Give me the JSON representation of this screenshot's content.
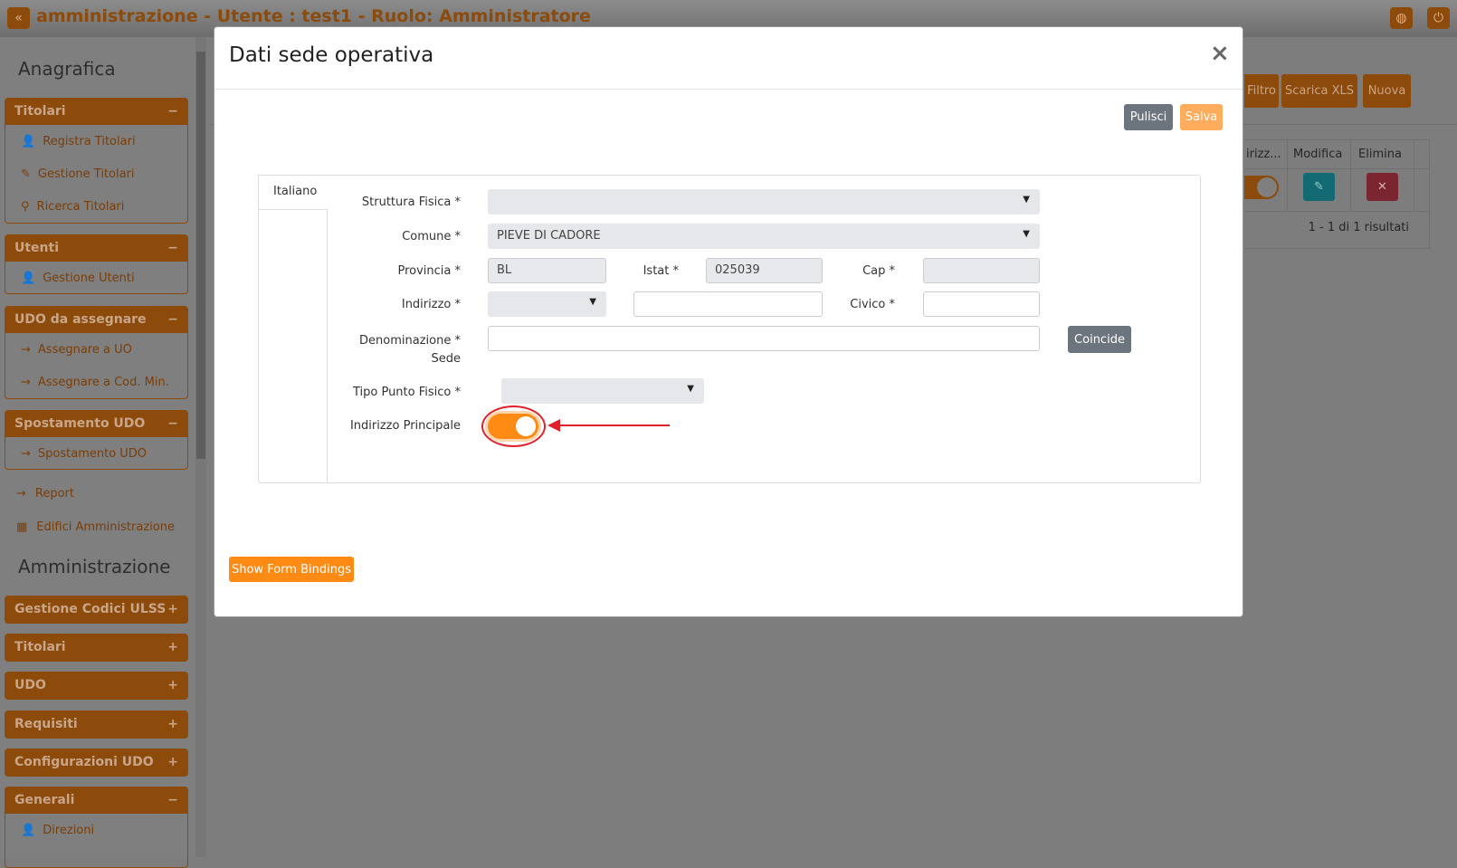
{
  "topbar": {
    "title": "amministrazione - Utente : test1 - Ruolo: Amministratore",
    "collapse_icon": "«",
    "globe_icon": "globe-icon",
    "power_icon": "power-icon"
  },
  "sidebar": {
    "heading1": "Anagrafica",
    "groups": [
      {
        "title": "Titolari",
        "toggle": "−",
        "items": [
          "Registra Titolari",
          "Gestione Titolari",
          "Ricerca Titolari"
        ]
      },
      {
        "title": "Utenti",
        "toggle": "−",
        "items": [
          "Gestione Utenti"
        ]
      },
      {
        "title": "UDO da assegnare",
        "toggle": "−",
        "items": [
          "Assegnare a UO",
          "Assegnare a Cod. Min."
        ]
      },
      {
        "title": "Spostamento UDO",
        "toggle": "−",
        "items": [
          "Spostamento UDO"
        ]
      }
    ],
    "links": [
      "Report",
      "Edifici Amministrazione"
    ],
    "heading2": "Amministrazione",
    "admin_groups": [
      {
        "title": "Gestione Codici ULSS",
        "toggle": "+"
      },
      {
        "title": "Titolari",
        "toggle": "+"
      },
      {
        "title": "UDO",
        "toggle": "+"
      },
      {
        "title": "Requisiti",
        "toggle": "+"
      },
      {
        "title": "Configurazioni UDO",
        "toggle": "+"
      },
      {
        "title": "Generali",
        "toggle": "−",
        "items": [
          "Direzioni"
        ]
      }
    ]
  },
  "background": {
    "buttons": [
      "Filtro",
      "Scarica XLS",
      "Nuova"
    ],
    "table_headers": [
      "irizz...",
      "Modifica",
      "Elimina"
    ],
    "pagination": "1 - 1 di 1 risultati"
  },
  "modal": {
    "title": "Dati sede operativa",
    "close": "×",
    "pulisci": "Pulisci",
    "salva": "Salva",
    "tab": "Italiano",
    "fields": {
      "struttura_fisica": {
        "label": "Struttura Fisica *",
        "value": ""
      },
      "comune": {
        "label": "Comune *",
        "value": "PIEVE DI CADORE"
      },
      "provincia": {
        "label": "Provincia *",
        "value": "BL"
      },
      "istat": {
        "label": "Istat *",
        "value": "025039"
      },
      "cap": {
        "label": "Cap *",
        "value": ""
      },
      "indirizzo": {
        "label": "Indirizzo *",
        "value": ""
      },
      "civico": {
        "label": "Civico *",
        "value": ""
      },
      "denominazione": {
        "label1": "Denominazione *",
        "label2": "Sede",
        "value": ""
      },
      "tipo_punto_fisico": {
        "label": "Tipo Punto Fisico *",
        "value": ""
      },
      "indirizzo_principale": {
        "label": "Indirizzo Principale",
        "on": true
      }
    },
    "coincide": "Coincide",
    "show_bindings": "Show Form Bindings"
  },
  "colors": {
    "accent": "#ff8a14",
    "annotation": "#e0202a",
    "salva": "#ffad5c",
    "pulisci": "#6c757d"
  }
}
